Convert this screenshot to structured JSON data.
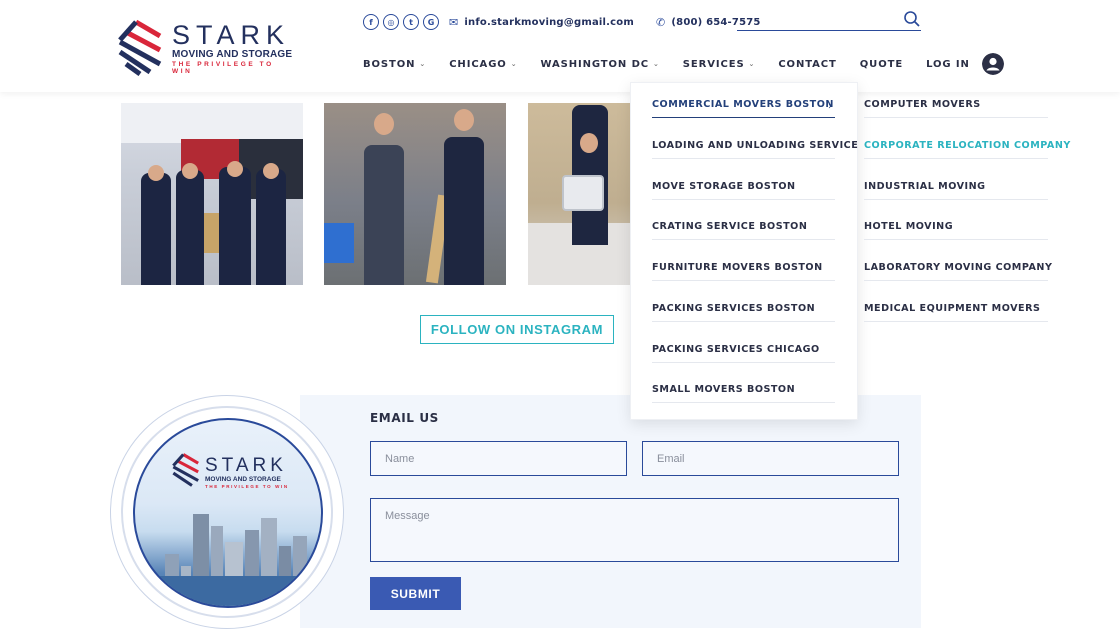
{
  "brand": {
    "name": "STARK",
    "subtitle": "MOVING AND STORAGE",
    "tagline": "THE PRIVILEGE TO WIN",
    "colors": {
      "navy": "#23305e",
      "red": "#d9263a",
      "accent": "#2bb3c0",
      "button": "#3a5ab3"
    }
  },
  "topbar": {
    "social_icons": [
      "facebook-icon",
      "instagram-icon",
      "tumblr-icon",
      "google-icon"
    ],
    "social_glyphs": [
      "f",
      "◎",
      "t",
      "G"
    ],
    "email": "info.starkmoving@gmail.com",
    "phone": "(800) 654-7575"
  },
  "nav": {
    "items": [
      {
        "label": "BOSTON",
        "dropdown": true
      },
      {
        "label": "CHICAGO",
        "dropdown": true
      },
      {
        "label": "WASHINGTON DC",
        "dropdown": true
      },
      {
        "label": "SERVICES",
        "dropdown": true
      },
      {
        "label": "CONTACT",
        "dropdown": false
      },
      {
        "label": "QUOTE",
        "dropdown": false
      },
      {
        "label": "LOG IN",
        "dropdown": false
      }
    ],
    "chevron": "⌄"
  },
  "services_menu": {
    "column_1": [
      "COMMERCIAL MOVERS BOSTON",
      "LOADING AND UNLOADING SERVICE",
      "MOVE STORAGE BOSTON",
      "CRATING SERVICE BOSTON",
      "FURNITURE MOVERS BOSTON",
      "PACKING SERVICES BOSTON",
      "PACKING SERVICES CHICAGO",
      "SMALL MOVERS BOSTON"
    ],
    "column_2": [
      "COMPUTER MOVERS",
      "CORPORATE RELOCATION COMPANY",
      "INDUSTRIAL MOVING",
      "HOTEL MOVING",
      "LABORATORY MOVING COMPANY",
      "MEDICAL EQUIPMENT MOVERS"
    ],
    "active_item": "COMMERCIAL MOVERS BOSTON",
    "hovered_item": "CORPORATE RELOCATION COMPANY",
    "arrow": "›"
  },
  "instagram": {
    "follow_label": "FOLLOW ON INSTAGRAM"
  },
  "contact_form": {
    "heading": "EMAIL US",
    "name_placeholder": "Name",
    "email_placeholder": "Email",
    "message_placeholder": "Message",
    "submit_label": "SUBMIT"
  }
}
